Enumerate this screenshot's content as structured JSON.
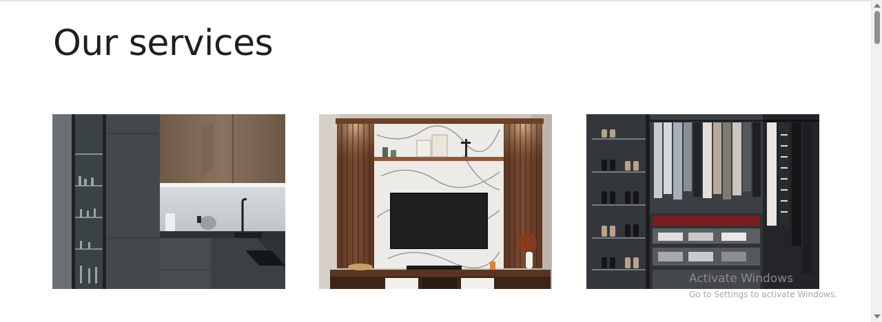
{
  "section": {
    "title": "Our services"
  },
  "services": [
    {
      "image_alt": "Modern dark grey kitchen with wooden upper cabinets"
    },
    {
      "image_alt": "TV wall unit with marble panel and wooden slats"
    },
    {
      "image_alt": "Walk-in wardrobe with shoe racks and hanging clothes"
    }
  ],
  "watermark": {
    "title": "Activate Windows",
    "subtitle": "Go to Settings to activate Windows."
  },
  "colors": {
    "heading": "#1f1f1f",
    "background": "#ffffff"
  }
}
